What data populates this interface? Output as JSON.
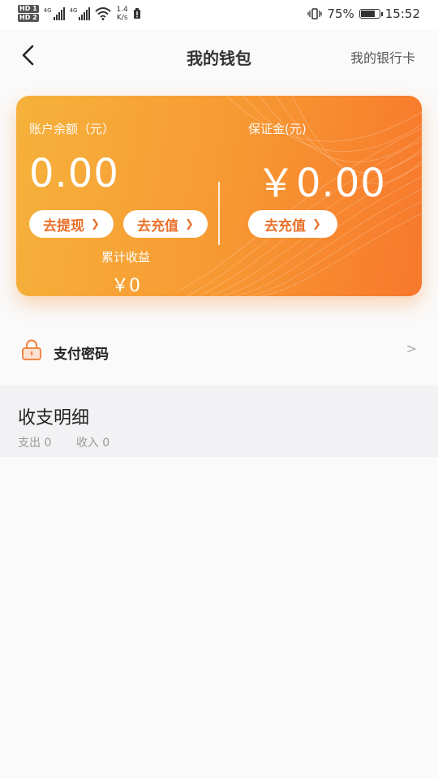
{
  "status_bar": {
    "hd1": "HD 1",
    "hd2": "HD 2",
    "net1": "4G",
    "net2": "4G",
    "speed_value": "1.4",
    "speed_unit": "K/s",
    "battery_percent": "75%",
    "time": "15:52"
  },
  "nav": {
    "title": "我的钱包",
    "right_link": "我的银行卡"
  },
  "wallet": {
    "balance_label": "账户余额（元）",
    "balance_value": "0.00",
    "withdraw_button": "去提现",
    "recharge_button": "去充值",
    "deposit_label": "保证金(元)",
    "deposit_value": "￥0.00",
    "deposit_recharge_button": "去充值",
    "income_label": "累计收益",
    "income_value": "￥0"
  },
  "payment_password": {
    "label": "支付密码",
    "arrow": ">"
  },
  "details": {
    "title": "收支明细",
    "expense": "支出 0",
    "income": "收入 0"
  },
  "colors": {
    "card_start": "#f6b23b",
    "card_end": "#f7782c",
    "accent_text": "#e8712a",
    "lock_icon": "#f0884a"
  }
}
